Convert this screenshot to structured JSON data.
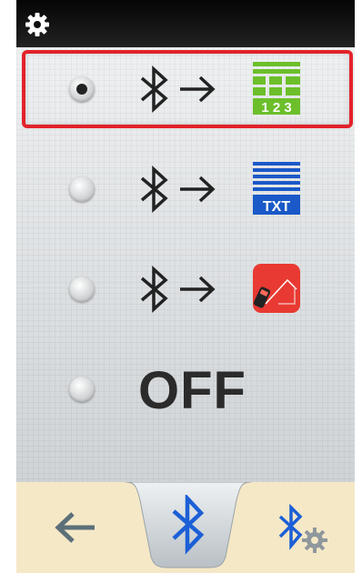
{
  "header": {
    "settings_icon": "gear-icon"
  },
  "options": [
    {
      "selected": true,
      "target_icon": "calculator-123-icon",
      "target_icon_text": "1 2 3"
    },
    {
      "selected": false,
      "target_icon": "txt-document-icon",
      "target_icon_text": "TXT"
    },
    {
      "selected": false,
      "target_icon": "measuring-app-icon"
    },
    {
      "selected": false,
      "label": "OFF"
    }
  ],
  "tabs": [
    {
      "icon": "back-arrow-icon"
    },
    {
      "icon": "bluetooth-icon",
      "active": true
    },
    {
      "icon": "bluetooth-settings-icon"
    }
  ],
  "colors": {
    "selection_border": "#e2222a",
    "bluetooth_active": "#1c5fd6",
    "calculator_green": "#6cbf2a",
    "txt_blue": "#1a59c7",
    "app_red": "#e83a32",
    "tab_bar": "#f5e8c7"
  }
}
